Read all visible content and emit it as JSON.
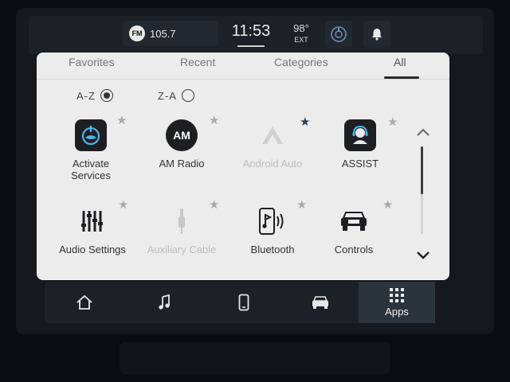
{
  "status": {
    "band_badge": "FM",
    "station": "105.7",
    "time": "11:53",
    "temperature": "98°",
    "temperature_label": "EXT"
  },
  "tabs": [
    {
      "label": "Favorites",
      "active": false
    },
    {
      "label": "Recent",
      "active": false
    },
    {
      "label": "Categories",
      "active": false
    },
    {
      "label": "All",
      "active": true
    }
  ],
  "sort": {
    "az_label": "A-Z",
    "za_label": "Z-A",
    "selected": "A-Z"
  },
  "apps": [
    {
      "label_line1": "Activate",
      "label_line2": "Services",
      "icon": "activate-services-icon",
      "favorite": false,
      "enabled": true
    },
    {
      "label": "AM Radio",
      "icon_text": "AM",
      "icon": "am-radio-icon",
      "favorite": false,
      "enabled": true
    },
    {
      "label": "Android Auto",
      "icon": "android-auto-icon",
      "favorite": true,
      "enabled": false
    },
    {
      "label": "ASSIST",
      "icon": "assist-headset-icon",
      "favorite": false,
      "enabled": true
    },
    {
      "label": "Audio Settings",
      "icon": "equalizer-icon",
      "favorite": false,
      "enabled": true
    },
    {
      "label": "Auxiliary Cable",
      "icon": "aux-cable-icon",
      "favorite": false,
      "enabled": false
    },
    {
      "label": "Bluetooth",
      "icon": "bluetooth-phone-icon",
      "favorite": false,
      "enabled": true
    },
    {
      "label": "Controls",
      "icon": "truck-controls-icon",
      "favorite": false,
      "enabled": true
    }
  ],
  "nav": {
    "items": [
      "home-icon",
      "music-note-icon",
      "phone-icon",
      "truck-icon",
      "apps-grid-icon"
    ],
    "apps_label": "Apps"
  },
  "colors": {
    "panel_bg": "#ececec",
    "bar_bg": "#1c2127",
    "active_nav_bg": "#2b333d",
    "favorite_star": "#2a3f5a"
  }
}
